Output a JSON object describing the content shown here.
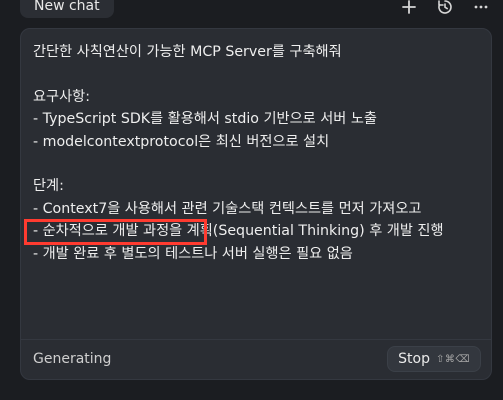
{
  "top": {
    "tab_label": "New chat",
    "icons": {
      "new": "plus-icon",
      "history": "history-icon",
      "more": "more-icon"
    }
  },
  "message": {
    "lines": [
      "간단한 사칙연산이 가능한 MCP Server를 구축해줘",
      "",
      "요구사항:",
      "- TypeScript SDK를 활용해서 stdio 기반으로 서버 노출",
      "- modelcontextprotocol은 최신 버전으로 설치",
      "",
      "단계:",
      "- Context7을 사용해서 관련 기술스택 컨텍스트를 먼저 가져오고",
      "- 순차적으로 개발 과정을 계획(Sequential Thinking) 후 개발 진행",
      "- 개발 완료 후 별도의 테스트나 서버 실행은 필요 없음"
    ]
  },
  "footer": {
    "status": "Generating",
    "stop_label": "Stop",
    "stop_shortcut": "⇧⌘⌫"
  },
  "colors": {
    "background": "#1b1d21",
    "card": "#2a2d33",
    "highlight": "#ff3b30"
  }
}
